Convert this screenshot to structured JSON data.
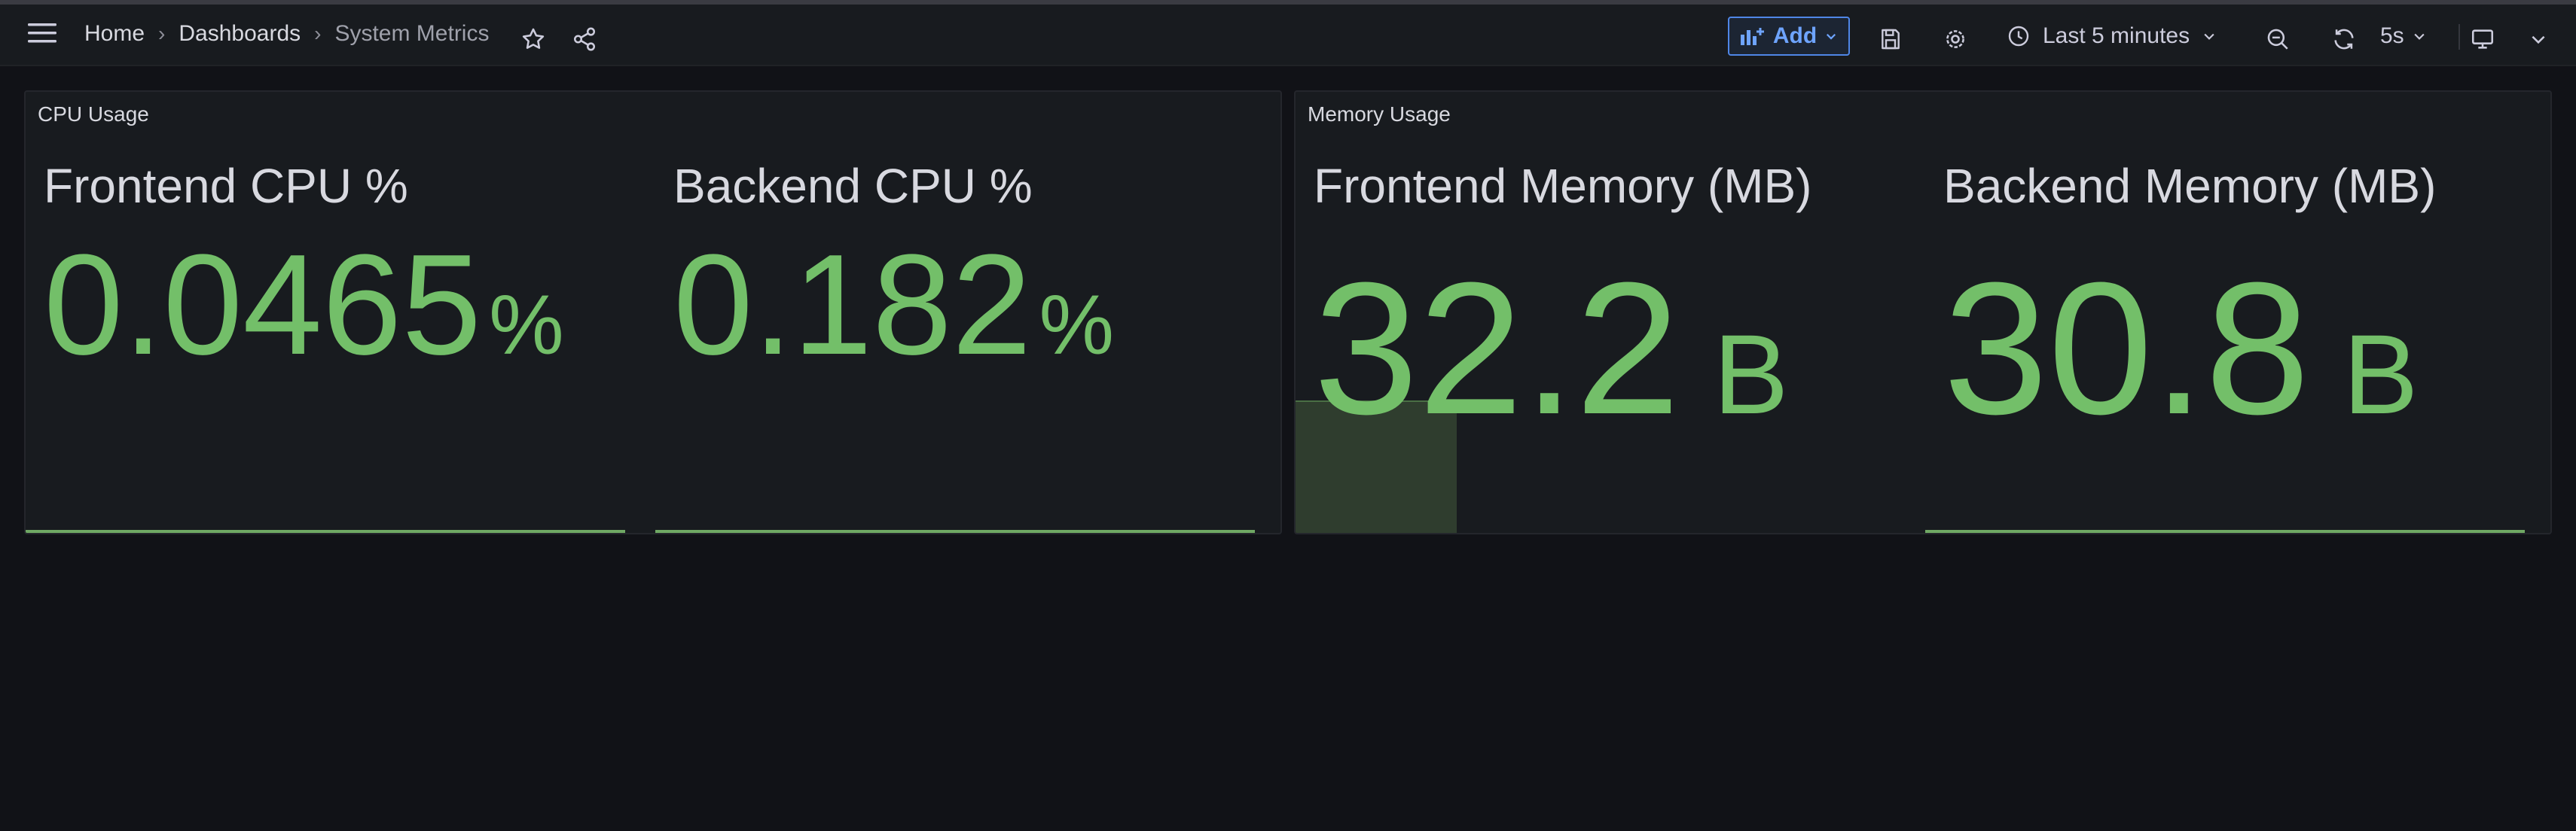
{
  "breadcrumb": {
    "home": "Home",
    "dashboards": "Dashboards",
    "current": "System Metrics",
    "separator": "›"
  },
  "toolbar": {
    "add_label": "Add",
    "time_range": "Last 5 minutes",
    "refresh_interval": "5s"
  },
  "panels": [
    {
      "title": "CPU Usage",
      "stats": [
        {
          "label": "Frontend CPU %",
          "value": "0.0465",
          "unit": "%"
        },
        {
          "label": "Backend CPU %",
          "value": "0.182",
          "unit": "%"
        }
      ]
    },
    {
      "title": "Memory Usage",
      "stats": [
        {
          "label": "Frontend Memory (MB)",
          "value": "32.2",
          "unit": "B"
        },
        {
          "label": "Backend Memory (MB)",
          "value": "30.8",
          "unit": "B"
        }
      ]
    }
  ],
  "colors": {
    "stat_green": "#73bf69",
    "accent_blue": "#4f86e6",
    "background": "#111217",
    "panel": "#181b1f"
  }
}
